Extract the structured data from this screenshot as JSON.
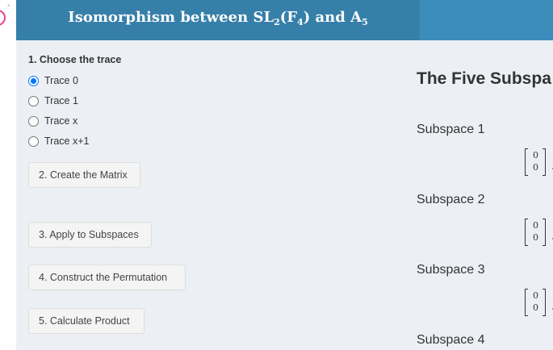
{
  "header": {
    "title_prefix": "Isomorphism between SL",
    "title_sub1": "2",
    "title_mid": "(F",
    "title_sub2": "4",
    "title_mid2": ") and A",
    "title_sub3": "5"
  },
  "sidebar": {
    "step1_label": "1. Choose the trace",
    "trace_options": [
      {
        "label": "Trace 0",
        "checked": true
      },
      {
        "label": "Trace 1",
        "checked": false
      },
      {
        "label": "Trace x",
        "checked": false
      },
      {
        "label": "Trace x+1",
        "checked": false
      }
    ],
    "buttons": {
      "create_matrix": "2. Create the Matrix",
      "apply_subspaces": "3. Apply to Subspaces",
      "construct_permutation": "4. Construct the Permutation",
      "calculate_product": "5. Calculate Product"
    }
  },
  "main": {
    "title": "The Five Subspa",
    "subspaces": [
      {
        "label": "Subspace 1",
        "vector": [
          "0",
          "0"
        ]
      },
      {
        "label": "Subspace 2",
        "vector": [
          "0",
          "0"
        ]
      },
      {
        "label": "Subspace 3",
        "vector": [
          "0",
          "0"
        ]
      },
      {
        "label": "Subspace 4"
      }
    ]
  },
  "colors": {
    "header_dark": "#367fa9",
    "header_light": "#3c8dbc",
    "panel_bg": "#ecf0f5",
    "radio_accent": "#0075ff"
  }
}
